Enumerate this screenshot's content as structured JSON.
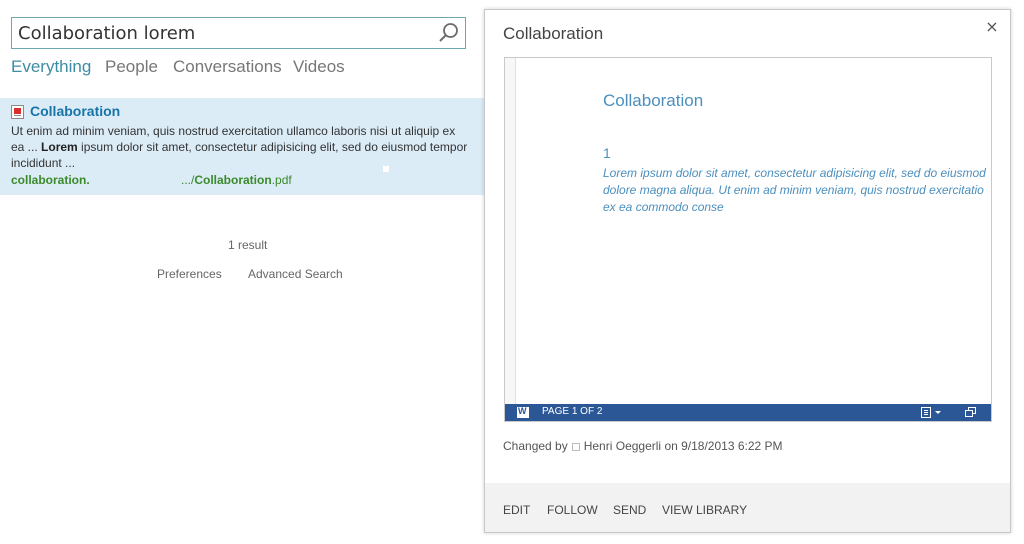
{
  "search": {
    "query": "Collaboration lorem",
    "verticals": [
      "Everything",
      "People",
      "Conversations",
      "Videos"
    ]
  },
  "result": {
    "title": "Collaboration",
    "snippet": {
      "line1": "Ut enim ad minim veniam, quis nostrud exercitation ullamco laboris nisi ut aliquip ex",
      "line2_prefix": "ea ... ",
      "line2_bold": "Lorem",
      "line2_rest": " ipsum dolor sit amet, consectetur adipisicing elit, sed do eiusmod tempor",
      "line3": "incididunt ..."
    },
    "url_part1": "collaboration.",
    "url_part2_prefix": ".../",
    "url_part2_bold": "Collaboration",
    "url_part2_ext": ".pdf"
  },
  "result_count": "1 result",
  "links": {
    "preferences": "Preferences",
    "advanced_search": "Advanced Search"
  },
  "hover_panel": {
    "title": "Collaboration",
    "close": "×",
    "document": {
      "title": "Collaboration",
      "number": "1",
      "body": [
        "Lorem ipsum dolor sit amet, consectetur adipisicing elit,  sed do eiusmod",
        "dolore magna aliqua. Ut enim ad minim veniam, quis nostrud exercitatio",
        "ex ea commodo conse"
      ]
    },
    "viewer_status": "PAGE 1 OF 2",
    "changed_by_label": "Changed by",
    "changed_by_user": "Henri Oeggerli",
    "changed_on": "on 9/18/2013 6:22 PM",
    "actions": [
      "EDIT",
      "FOLLOW",
      "SEND",
      "VIEW LIBRARY"
    ]
  },
  "colors": {
    "accent": "#3d8ea3",
    "result_bg": "#dbecf7",
    "link_title": "#1874a8",
    "url_green": "#3b8a2b",
    "doc_blue": "#4b8fbe",
    "viewer_bar": "#2b5797"
  },
  "icons": {
    "search": "search-icon",
    "pdf": "pdf-file-icon",
    "close": "close-icon",
    "word": "word-app-icon",
    "view_menu": "view-menu-icon",
    "popout": "popout-icon"
  }
}
